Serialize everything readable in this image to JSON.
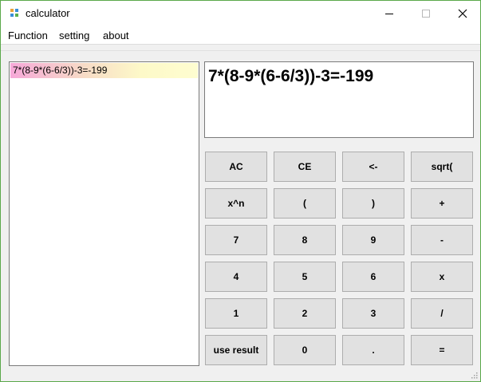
{
  "window": {
    "title": "calculator",
    "icon": "app-grid-icon",
    "controls": [
      "minimize-icon",
      "maximize-icon",
      "close-icon"
    ]
  },
  "menu": {
    "items": [
      "Function",
      "setting",
      "about"
    ]
  },
  "history": {
    "entries": [
      "7*(8-9*(6-6/3))-3=-199"
    ]
  },
  "display": {
    "expression": "7*(8-9*(6-6/3))-3=-199"
  },
  "keypad": {
    "rows": [
      [
        "AC",
        "CE",
        "<-",
        "sqrt("
      ],
      [
        "x^n",
        "(",
        ")",
        "+"
      ],
      [
        "7",
        "8",
        "9",
        "-"
      ],
      [
        "4",
        "5",
        "6",
        "x"
      ],
      [
        "1",
        "2",
        "3",
        "/"
      ],
      [
        "use result",
        "0",
        ".",
        "="
      ]
    ]
  }
}
